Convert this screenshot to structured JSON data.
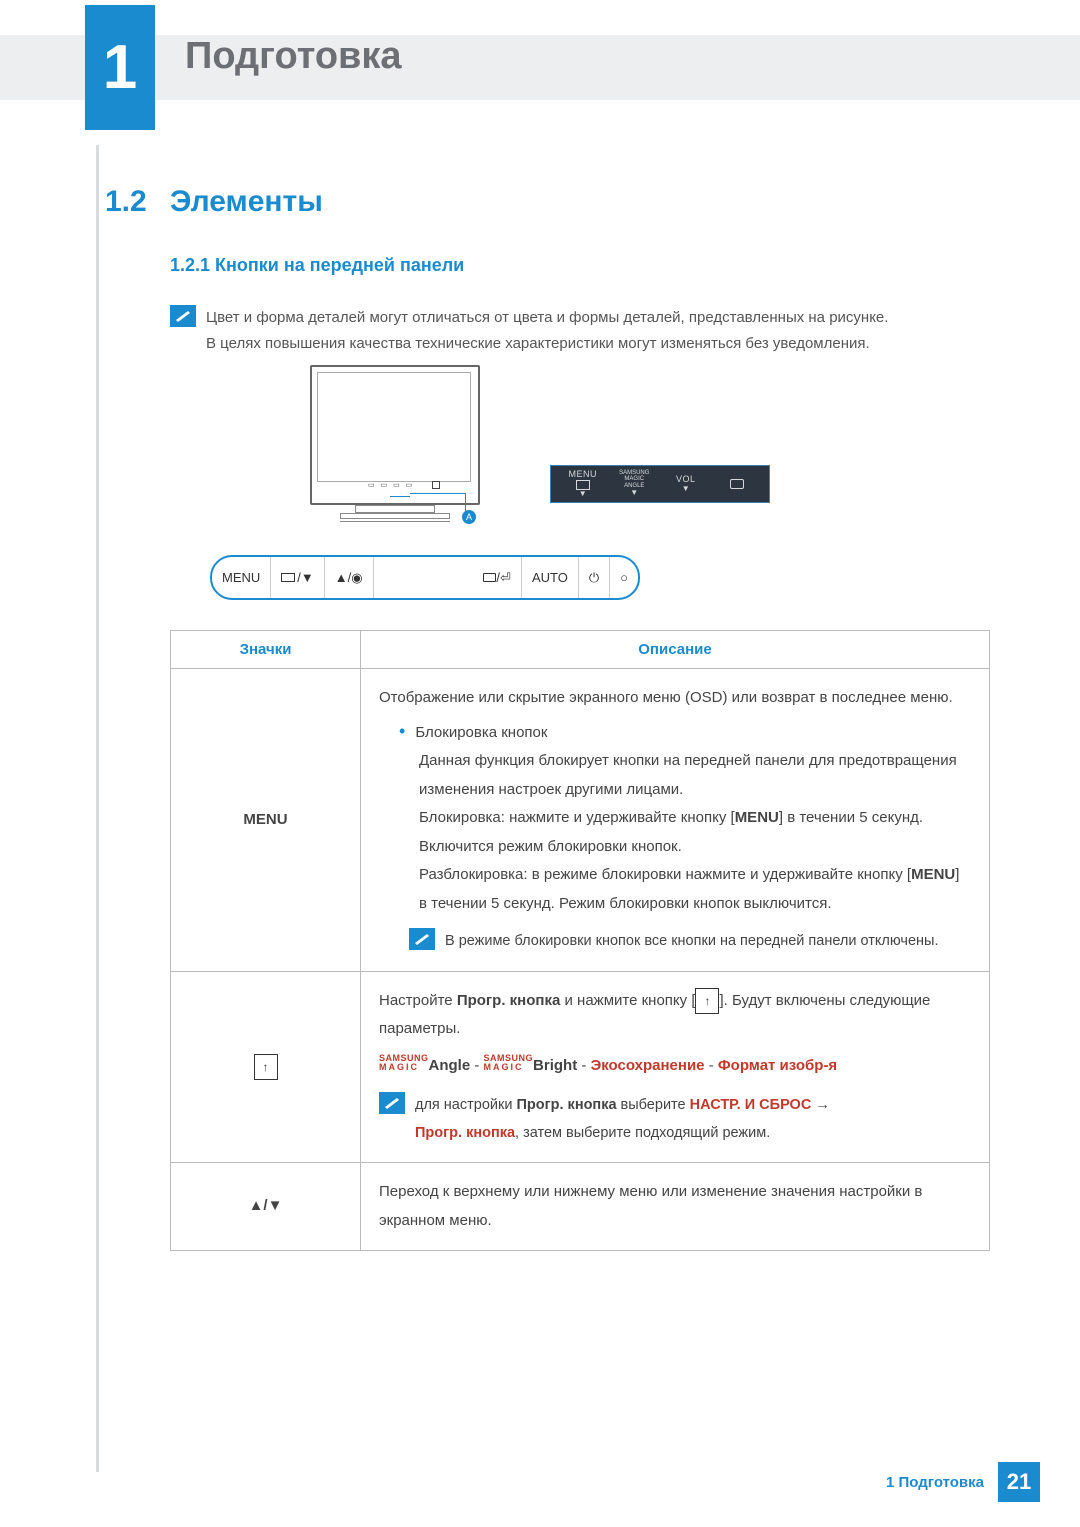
{
  "chapter": {
    "num": "1",
    "title": "Подготовка"
  },
  "section": {
    "num": "1.2",
    "title": "Элементы"
  },
  "subsection": {
    "numtitle": "1.2.1  Кнопки на передней панели"
  },
  "top_note": {
    "line1": "Цвет и форма деталей могут отличаться от цвета и формы деталей, представленных на рисунке.",
    "line2": "В целях повышения качества технические характеристики могут изменяться без уведомления."
  },
  "panel": {
    "menu": "MENU",
    "samsung": "SAMSUNG",
    "magic1": "MAGIC",
    "magic2": "ANGLE",
    "vol": "VOL",
    "callout": "A"
  },
  "button_row": {
    "b1": "MENU",
    "b2_tri": "▼",
    "b3_tri": "▲/◉",
    "b4": "AUTO"
  },
  "table": {
    "h1": "Значки",
    "h2": "Описание",
    "row1": {
      "icon": "MENU",
      "p1": "Отображение или скрытие экранного меню (OSD) или возврат в последнее меню.",
      "bullet": "Блокировка кнопок",
      "p2": "Данная функция блокирует кнопки на передней панели для предотвращения изменения настроек другими лицами.",
      "p3a": "Блокировка: нажмите и удерживайте кнопку [",
      "p3b": "] в течении 5 секунд. Включится режим блокировки кнопок.",
      "p4a": "Разблокировка: в режиме блокировки нажмите и удерживайте кнопку [",
      "p4b": "] в течении 5 секунд. Режим блокировки кнопок выключится.",
      "note": "В режиме блокировки кнопок все кнопки на передней панели отключены.",
      "menu_kw": "MENU"
    },
    "row2": {
      "p1a": "Настройте ",
      "p1b": "Прогр. кнопка",
      "p1c": " и нажмите кнопку [",
      "p1d": "]. Будут включены следующие параметры.",
      "opt_angle": "Angle",
      "opt_bright": "Bright",
      "opt_eco": "Экосохранение",
      "opt_format": "Формат изобр-я",
      "sep": " - ",
      "note_a": "для настройки ",
      "note_b": "Прогр. кнопка",
      "note_c": " выберите ",
      "note_d": "НАСТР. И СБРОС",
      "note_arrow": "  →",
      "note_e": "Прогр. кнопка",
      "note_f": ", затем выберите подходящий режим."
    },
    "row3": {
      "icon": "▲/▼",
      "text": "Переход к верхнему или нижнему меню или изменение значения настройки в экранном меню."
    }
  },
  "magic_label": {
    "l1": "SAMSUNG",
    "l2": "MAGIC"
  },
  "footer": {
    "label": "1 Подготовка",
    "page": "21"
  }
}
